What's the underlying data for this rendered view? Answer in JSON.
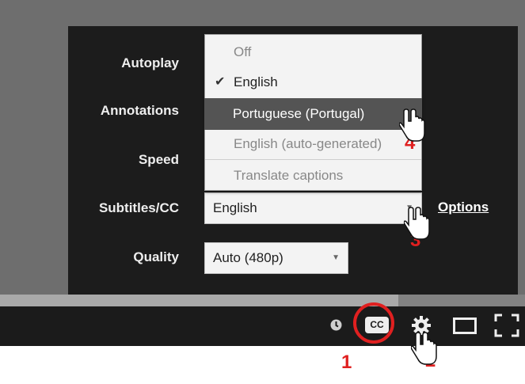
{
  "settings": {
    "autoplay_label": "Autoplay",
    "annotations_label": "Annotations",
    "speed_label": "Speed",
    "subtitles_label": "Subtitles/CC",
    "quality_label": "Quality",
    "subtitles_value": "English",
    "quality_value": "Auto (480p)",
    "options_link": "Options"
  },
  "subtitles_dropdown": {
    "items": [
      {
        "label": "Off",
        "state": "normal"
      },
      {
        "label": "English",
        "state": "checked"
      },
      {
        "label": "Portuguese (Portugal)",
        "state": "highlighted"
      },
      {
        "label": "English (auto-generated)",
        "state": "disabled"
      },
      {
        "label": "Translate captions",
        "state": "disabled"
      }
    ]
  },
  "controls": {
    "cc_label": "CC",
    "icons": [
      "clock-icon",
      "cc-icon",
      "gear-icon",
      "theater-mode-icon",
      "fullscreen-icon"
    ]
  },
  "annotations": {
    "steps": [
      "1",
      "2",
      "3",
      "4"
    ]
  },
  "colors": {
    "panel_bg": "#1c1c1c",
    "highlight_bg": "#545454",
    "annotation_red": "#e02020"
  }
}
